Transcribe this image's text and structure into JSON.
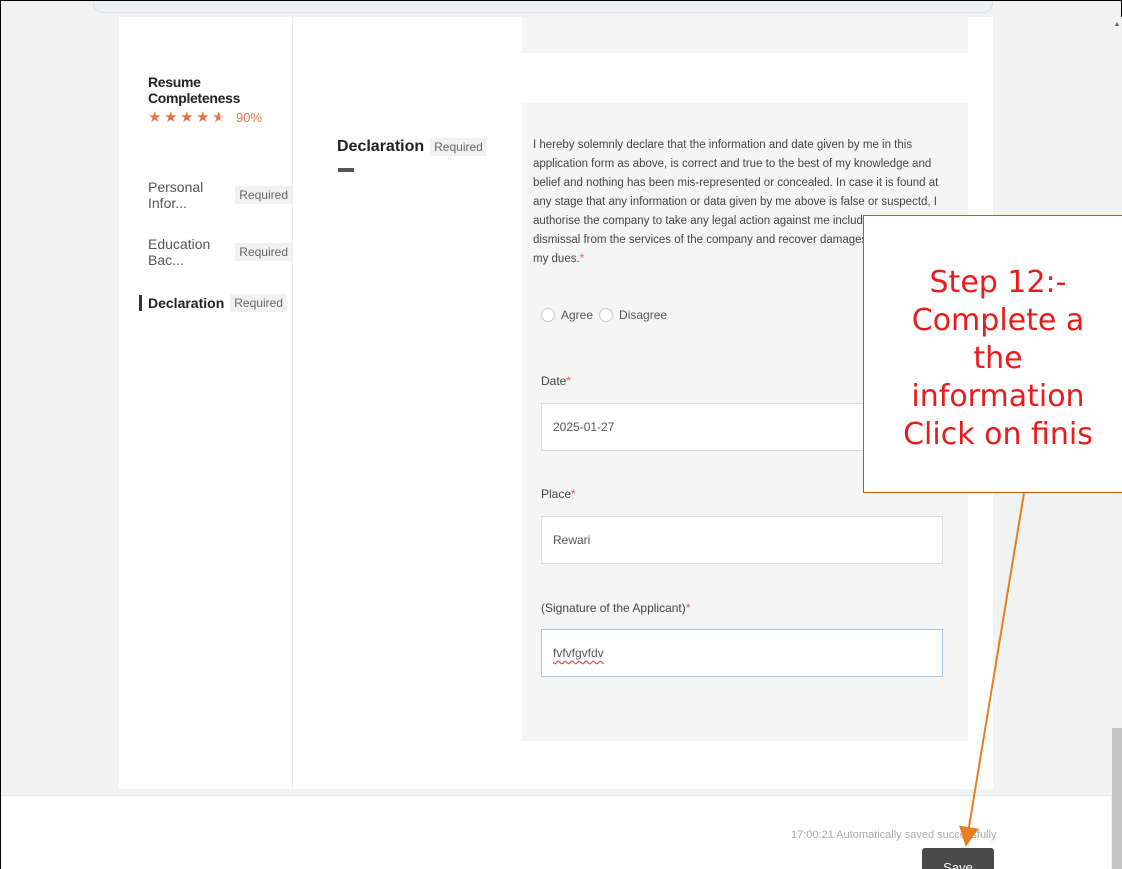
{
  "sidebar": {
    "completeness_title": "Resume Completeness",
    "rating_percent": "90%",
    "rating_value": 4.5,
    "rating_max": 5,
    "accent_color": "#e8734a",
    "items": [
      {
        "label": "Personal Infor...",
        "tag": "Required"
      },
      {
        "label": "Education Bac...",
        "tag": "Required"
      },
      {
        "label": "Declaration",
        "tag": "Required"
      }
    ]
  },
  "section": {
    "title": "Declaration",
    "tag": "Required"
  },
  "declaration": {
    "text": "I hereby solemnly declare that the information and date given by me in this application form as above, is correct and true to the best of my knowledge and belief and nothing has been mis-represented or concealed. In case it is found at any stage that any information or data given by me above is false or suspectd, I authorise the company to take any legal action against me including my summarily dismissal from the services of the company and recover damages if any, from me / my dues.",
    "required_mark": "*",
    "options": [
      "Agree",
      "Disagree"
    ]
  },
  "fields": {
    "date": {
      "label": "Date",
      "value": "2025-01-27"
    },
    "place": {
      "label": "Place",
      "value": "Rewari"
    },
    "signature": {
      "label": "(Signature of the Applicant)",
      "value": "fvfvfgvfdv"
    }
  },
  "footer": {
    "autosave": "17:00:21 Automatically saved successfully",
    "save_label": "Save"
  },
  "callout": {
    "lines": [
      "Step 12:-",
      "Complete a",
      "the",
      "information",
      "Click on finis"
    ],
    "color": "#e81c1c",
    "border_color": "#d35400"
  },
  "icons": {
    "star": "★",
    "scroll_up": "▲"
  }
}
